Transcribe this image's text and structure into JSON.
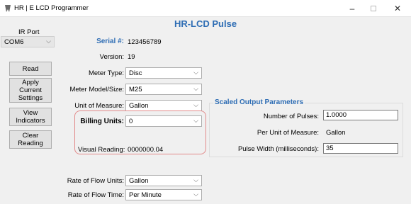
{
  "window": {
    "title": "HR | E LCD Programmer",
    "minimize_glyph": "–",
    "close_glyph": "✕"
  },
  "page_title": "HR-LCD Pulse",
  "ir_port": {
    "label": "IR Port",
    "value": "COM6"
  },
  "buttons": {
    "read": "Read",
    "apply": [
      "Apply",
      "Current",
      "Settings"
    ],
    "view": [
      "View",
      "Indicators"
    ],
    "clear": [
      "Clear",
      "Reading"
    ]
  },
  "fields": {
    "serial_label": "Serial #:",
    "serial_value": "123456789",
    "version_label": "Version:",
    "version_value": "19",
    "meter_type_label": "Meter Type:",
    "meter_type_value": "Disc",
    "meter_model_label": "Meter Model/Size:",
    "meter_model_value": "M25",
    "unit_label": "Unit of Measure:",
    "unit_value": "Gallon",
    "billing_label": "Billing Units:",
    "billing_value": "0",
    "visual_label": "Visual Reading:",
    "visual_value": "0000000.04",
    "flow_units_label": "Rate of Flow Units:",
    "flow_units_value": "Gallon",
    "flow_time_label": "Rate of Flow Time:",
    "flow_time_value": "Per Minute"
  },
  "scaled_output": {
    "title": "Scaled Output Parameters",
    "pulses_label": "Number of Pulses:",
    "pulses_value": "1.0000",
    "per_unit_label": "Per Unit of Measure:",
    "per_unit_value": "Gallon",
    "pulse_width_label": "Pulse Width (milliseconds):",
    "pulse_width_value": "35"
  },
  "colors": {
    "accent": "#2e6db4",
    "highlight_border": "#e28a8a"
  },
  "icons": {
    "app": "app-icon",
    "dropdown": "chevron-down-icon"
  }
}
